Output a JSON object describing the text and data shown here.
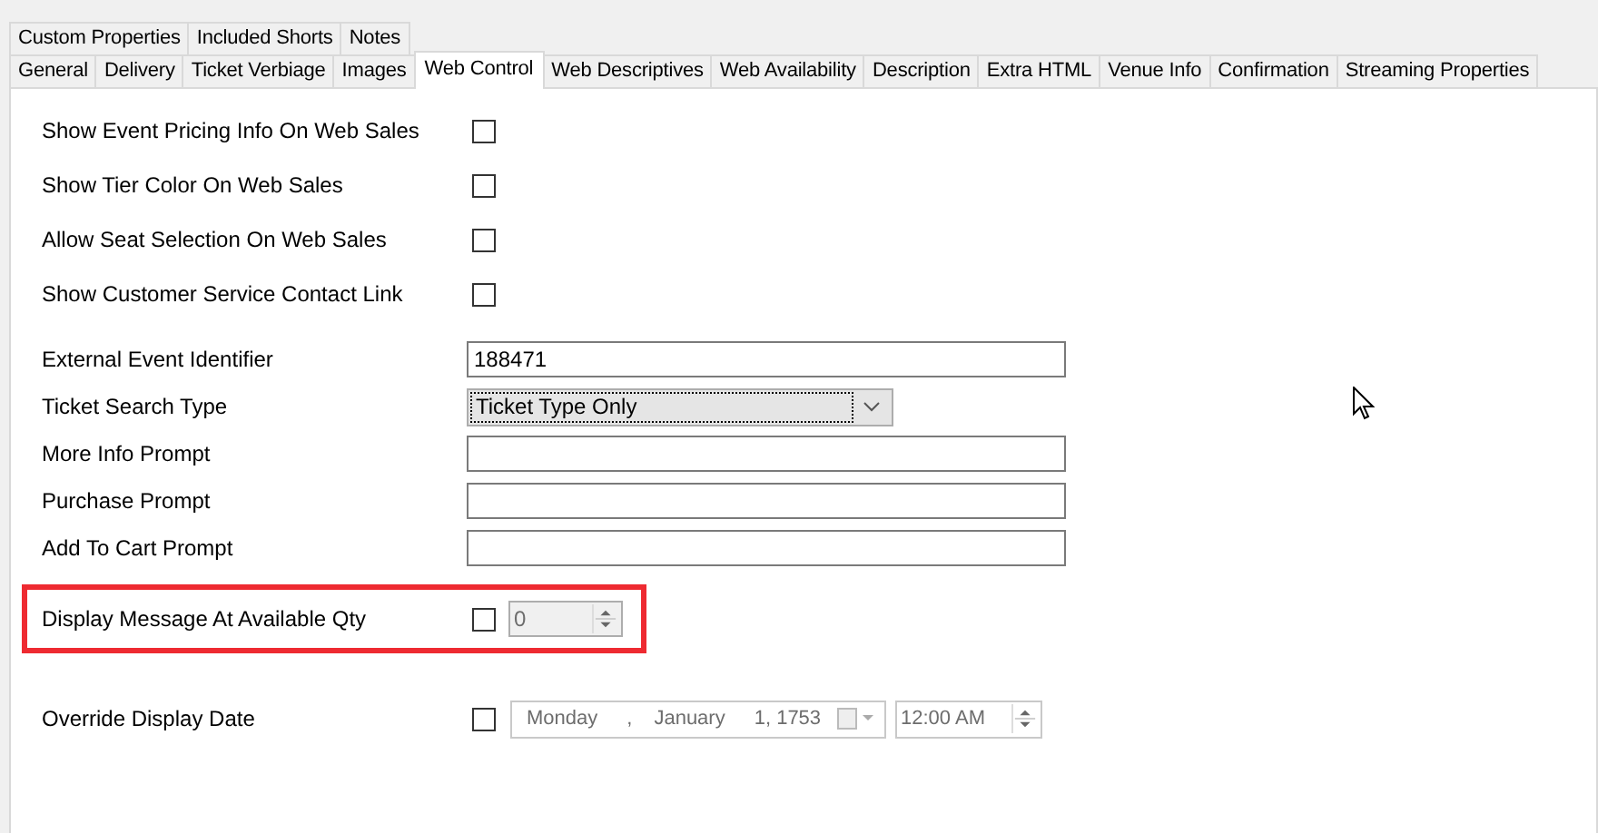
{
  "tab_rows": [
    {
      "tabs": [
        {
          "label": "Custom Properties",
          "selected": false
        },
        {
          "label": "Included Shorts",
          "selected": false
        },
        {
          "label": "Notes",
          "selected": false
        }
      ]
    },
    {
      "tabs": [
        {
          "label": "General",
          "selected": false
        },
        {
          "label": "Delivery",
          "selected": false
        },
        {
          "label": "Ticket Verbiage",
          "selected": false
        },
        {
          "label": "Images",
          "selected": false
        },
        {
          "label": "Web Control",
          "selected": true
        },
        {
          "label": "Web Descriptives",
          "selected": false
        },
        {
          "label": "Web Availability",
          "selected": false
        },
        {
          "label": "Description",
          "selected": false
        },
        {
          "label": "Extra HTML",
          "selected": false
        },
        {
          "label": "Venue Info",
          "selected": false
        },
        {
          "label": "Confirmation",
          "selected": false
        },
        {
          "label": "Streaming Properties",
          "selected": false
        }
      ]
    }
  ],
  "fields": [
    {
      "kind": "checkbox",
      "label": "Show Event Pricing Info On Web Sales",
      "checked": false
    },
    {
      "kind": "checkbox",
      "label": "Show Tier Color On Web Sales",
      "checked": false
    },
    {
      "kind": "checkbox",
      "label": "Allow Seat Selection On Web Sales",
      "checked": false
    },
    {
      "kind": "checkbox",
      "label": "Show Customer Service Contact Link",
      "checked": false
    },
    {
      "kind": "text",
      "label": "External Event Identifier",
      "value": "188471"
    },
    {
      "kind": "dropdown",
      "label": "Ticket Search Type",
      "value": "Ticket Type Only"
    },
    {
      "kind": "text",
      "label": "More Info Prompt"
    },
    {
      "kind": "text",
      "label": "Purchase Prompt"
    },
    {
      "kind": "text",
      "label": "Add To Cart Prompt"
    },
    {
      "kind": "numeric",
      "label": "Display Message At Available Qty",
      "checked": false,
      "value": "0",
      "disabled": true,
      "highlighted": true
    },
    {
      "kind": "datetime",
      "label": "Override Display Date",
      "checked": false,
      "day": "Monday",
      "separator": ",",
      "month": "January",
      "date": "1, 1753",
      "time": "12:00 AM",
      "disabled": true
    }
  ]
}
